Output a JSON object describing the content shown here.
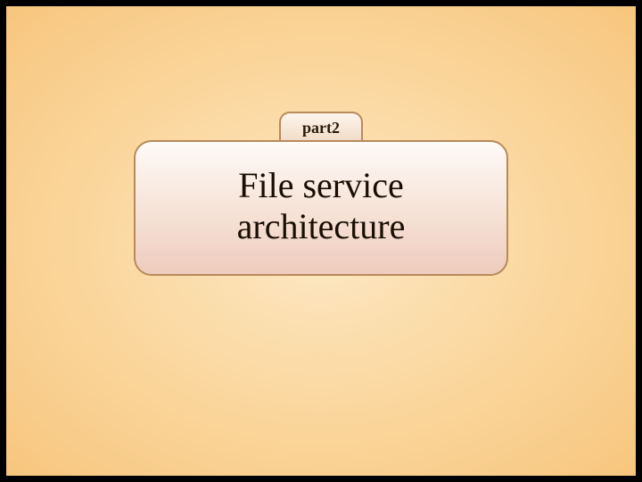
{
  "slide": {
    "tab_label": "part2",
    "title": "File service architecture"
  },
  "colors": {
    "frame_border": "#000000",
    "bg_inner": "#fce8c5",
    "bg_outer": "#f7c67e",
    "box_border": "#b78a5c",
    "text": "#1a0e04"
  }
}
